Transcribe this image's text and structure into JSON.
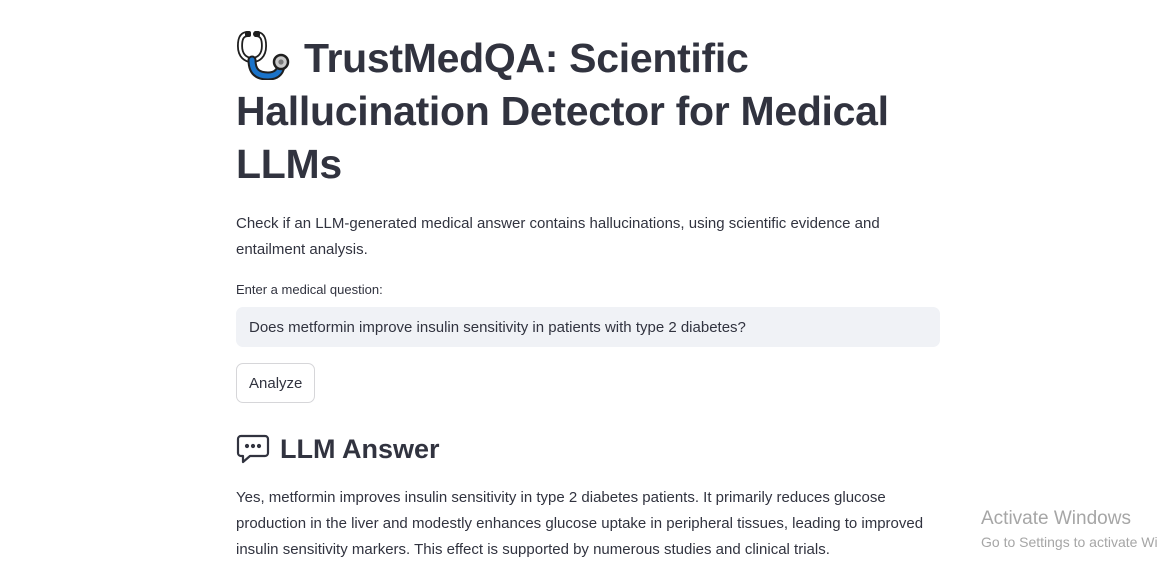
{
  "header": {
    "icon": "stethoscope-icon",
    "title": "TrustMedQA: Scientific Hallucination Detector for Medical LLMs"
  },
  "description": "Check if an LLM-generated medical answer contains hallucinations, using scientific evidence and entailment analysis.",
  "question_field": {
    "label": "Enter a medical question:",
    "value": "Does metformin improve insulin sensitivity in patients with type 2 diabetes?"
  },
  "analyze_button": {
    "label": "Analyze"
  },
  "llm_answer": {
    "icon": "speech-bubble-icon",
    "heading": "LLM Answer",
    "text": "Yes, metformin improves insulin sensitivity in type 2 diabetes patients. It primarily reduces glucose production in the liver and modestly enhances glucose uptake in peripheral tissues, leading to improved insulin sensitivity markers. This effect is supported by numerous studies and clinical trials."
  },
  "watermark": {
    "title": "Activate Windows",
    "subtitle": "Go to Settings to activate Windows."
  },
  "colors": {
    "text": "#31333f",
    "input_bg": "#f0f2f6",
    "button_border": "#d6d6d9",
    "icon_blue": "#1a73c9",
    "watermark": "#a6a6a6"
  }
}
